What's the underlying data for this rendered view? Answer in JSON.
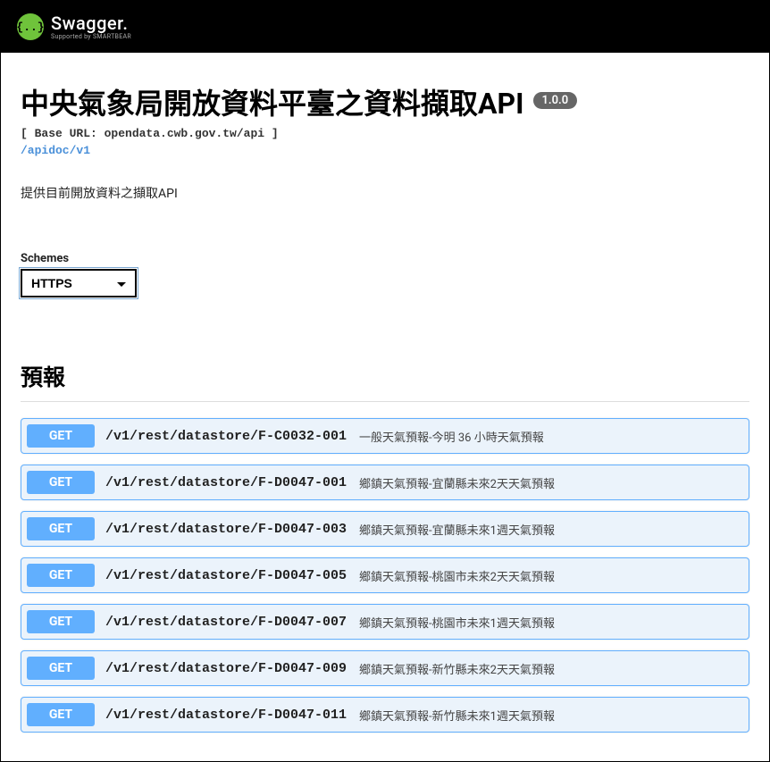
{
  "header": {
    "logo_glyph": "{..}",
    "logo_title": "Swagger.",
    "logo_subtitle": "Supported by SMARTBEAR"
  },
  "info": {
    "title": "中央氣象局開放資料平臺之資料擷取API",
    "version": "1.0.0",
    "base_url": "[ Base URL: opendata.cwb.gov.tw/api ]",
    "apidoc_link": "/apidoc/v1",
    "description": "提供目前開放資料之擷取API"
  },
  "schemes": {
    "label": "Schemes",
    "selected": "HTTPS"
  },
  "section": {
    "title": "預報"
  },
  "endpoints": [
    {
      "method": "GET",
      "path": "/v1/rest/datastore/F-C0032-001",
      "desc": "一般天氣預報-今明 36 小時天氣預報"
    },
    {
      "method": "GET",
      "path": "/v1/rest/datastore/F-D0047-001",
      "desc": "鄉鎮天氣預報-宜蘭縣未來2天天氣預報"
    },
    {
      "method": "GET",
      "path": "/v1/rest/datastore/F-D0047-003",
      "desc": "鄉鎮天氣預報-宜蘭縣未來1週天氣預報"
    },
    {
      "method": "GET",
      "path": "/v1/rest/datastore/F-D0047-005",
      "desc": "鄉鎮天氣預報-桃園市未來2天天氣預報"
    },
    {
      "method": "GET",
      "path": "/v1/rest/datastore/F-D0047-007",
      "desc": "鄉鎮天氣預報-桃園市未來1週天氣預報"
    },
    {
      "method": "GET",
      "path": "/v1/rest/datastore/F-D0047-009",
      "desc": "鄉鎮天氣預報-新竹縣未來2天天氣預報"
    },
    {
      "method": "GET",
      "path": "/v1/rest/datastore/F-D0047-011",
      "desc": "鄉鎮天氣預報-新竹縣未來1週天氣預報"
    }
  ]
}
